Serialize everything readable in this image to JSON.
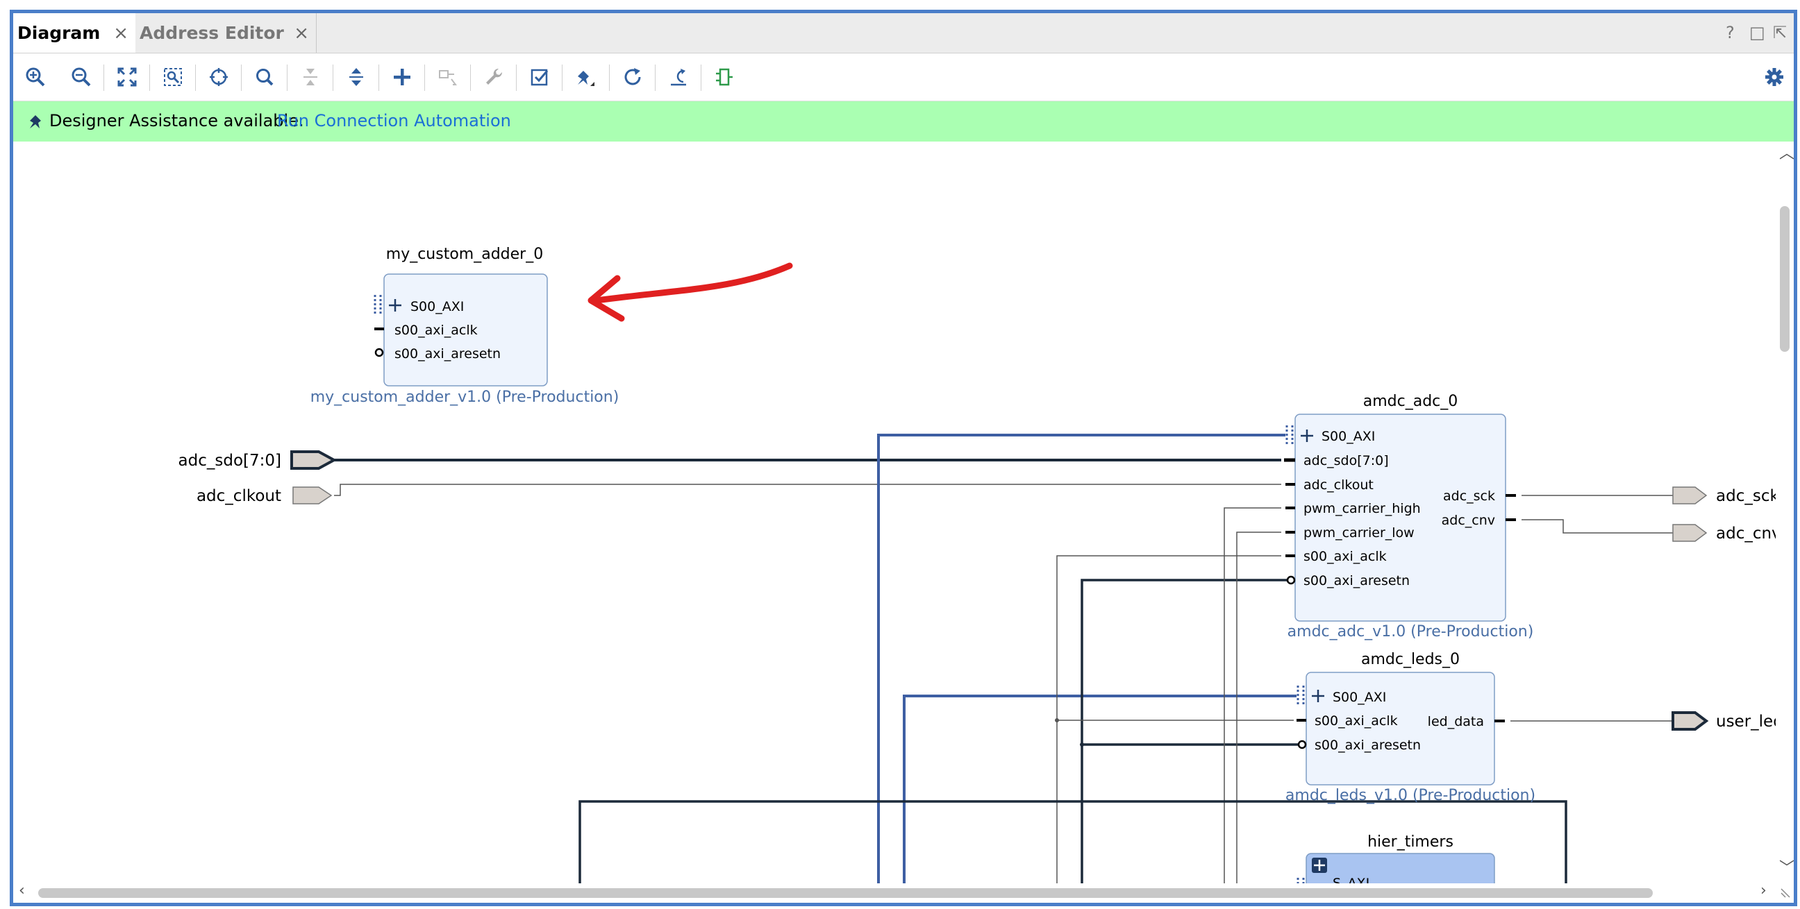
{
  "tabs": [
    {
      "label": "Diagram",
      "active": true
    },
    {
      "label": "Address Editor",
      "active": false
    }
  ],
  "close_glyph": "×",
  "window_controls": {
    "help": "?",
    "restore": "□",
    "popout": "⇱"
  },
  "toolbar": {
    "buttons": [
      "zoom-in",
      "zoom-out",
      "zoom-fit",
      "zoom-selection",
      "auto-fit-selection",
      "search",
      "collapse-all",
      "expand-all",
      "add-ip",
      "make-connection",
      "validate-design",
      "customize",
      "regenerate-layout",
      "optimize-routing",
      "pin-tool"
    ],
    "settings_icon": "gear-icon"
  },
  "assist": {
    "message": "Designer Assistance available.",
    "link": "Run Connection Automation"
  },
  "blocks": {
    "adder": {
      "title": "my_custom_adder_0",
      "subtitle": "my_custom_adder_v1.0 (Pre-Production)",
      "ports": [
        "S00_AXI",
        "s00_axi_aclk",
        "s00_axi_aresetn"
      ]
    },
    "adc": {
      "title": "amdc_adc_0",
      "subtitle": "amdc_adc_v1.0 (Pre-Production)",
      "inputs": [
        "S00_AXI",
        "adc_sdo[7:0]",
        "adc_clkout",
        "pwm_carrier_high",
        "pwm_carrier_low",
        "s00_axi_aclk",
        "s00_axi_aresetn"
      ],
      "outputs": [
        "adc_sck",
        "adc_cnv"
      ]
    },
    "leds": {
      "title": "amdc_leds_0",
      "subtitle": "amdc_leds_v1.0 (Pre-Production)",
      "inputs": [
        "S00_AXI",
        "s00_axi_aclk",
        "s00_axi_aresetn"
      ],
      "outputs": [
        "led_data"
      ]
    },
    "hier": {
      "title": "hier_timers",
      "first_port": "S_AXI"
    }
  },
  "external_ports": {
    "adc_sdo": "adc_sdo[7:0]",
    "adc_clkout": "adc_clkout",
    "adc_sck": "adc_sck",
    "adc_cnv": "adc_cnv",
    "user_led": "user_led_"
  },
  "colors": {
    "frame": "#4a7ec9",
    "assist_bg": "#aaffb2",
    "link": "#1a6fd6",
    "block_fill": "#eef4fd",
    "block_stroke": "#7f9dc5",
    "hier_fill": "#a9c4f1",
    "subtitle": "#4a6fa5",
    "bus": "#3e5fa3",
    "wire_dark": "#1c2a3a",
    "annotation": "#e02020"
  }
}
